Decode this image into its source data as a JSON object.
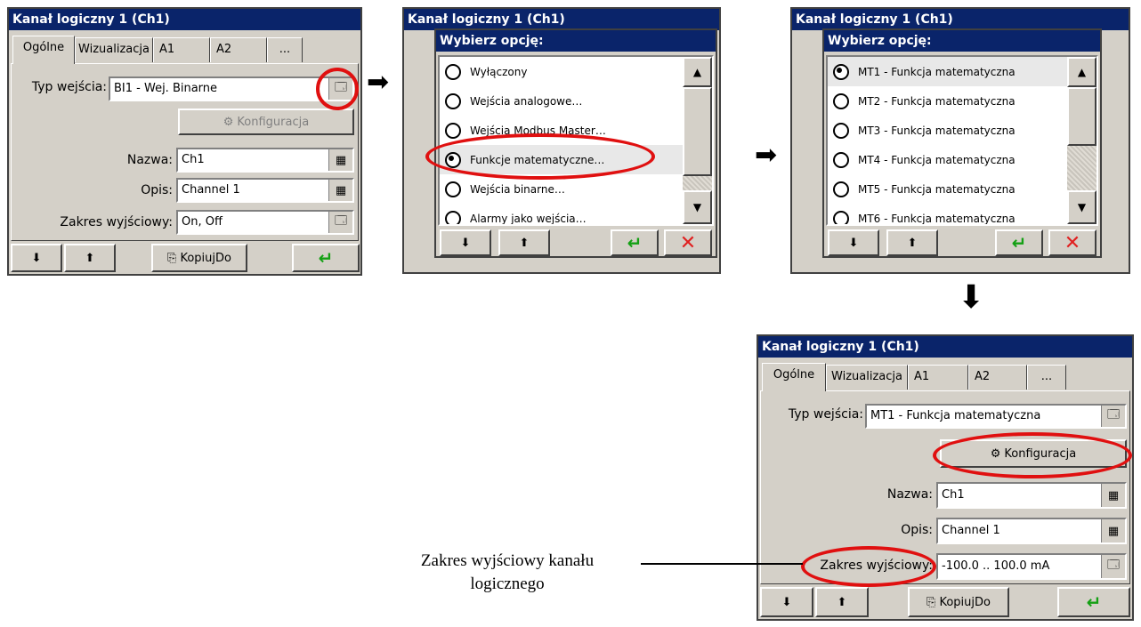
{
  "window_title": "Kanał logiczny 1 (Ch1)",
  "tabs": [
    "Ogólne",
    "Wizualizacja",
    "A1",
    "A2",
    "..."
  ],
  "screen1": {
    "input_type_label": "Typ wejścia:",
    "input_type_value": "BI1 - Wej. Binarne",
    "config_button": "Konfiguracja",
    "name_label": "Nazwa:",
    "name_value": "Ch1",
    "desc_label": "Opis:",
    "desc_value": "Channel 1",
    "range_label": "Zakres wyjściowy:",
    "range_value": "On, Off",
    "copy_button": "KopiujDo"
  },
  "dialog_title": "Wybierz opcję:",
  "dialog1_options": [
    {
      "label": "Wyłączony",
      "selected": false
    },
    {
      "label": "Wejścia analogowe…",
      "selected": false
    },
    {
      "label": "Wejścia Modbus Master…",
      "selected": false
    },
    {
      "label": "Funkcje matematyczne…",
      "selected": true
    },
    {
      "label": "Wejścia binarne…",
      "selected": false
    },
    {
      "label": "Alarmy jako wejścia…",
      "selected": false
    }
  ],
  "dialog2_options": [
    {
      "label": "MT1 - Funkcja matematyczna",
      "selected": true
    },
    {
      "label": "MT2 - Funkcja matematyczna",
      "selected": false
    },
    {
      "label": "MT3 - Funkcja matematyczna",
      "selected": false
    },
    {
      "label": "MT4 - Funkcja matematyczna",
      "selected": false
    },
    {
      "label": "MT5 - Funkcja matematyczna",
      "selected": false
    },
    {
      "label": "MT6 - Funkcja matematyczna",
      "selected": false
    }
  ],
  "screen4": {
    "input_type_label": "Typ wejścia:",
    "input_type_value": "MT1 - Funkcja matematyczna",
    "config_button": "Konfiguracja",
    "name_label": "Nazwa:",
    "name_value": "Ch1",
    "desc_label": "Opis:",
    "desc_value": "Channel 1",
    "range_label": "Zakres wyjściowy:",
    "range_value": "-100.0 .. 100.0 mA",
    "copy_button": "KopiujDo"
  },
  "annotation_line1": "Zakres wyjściowy kanału",
  "annotation_line2": "logicznego",
  "highlight_color": "#e01010",
  "title_color": "#0a246a"
}
